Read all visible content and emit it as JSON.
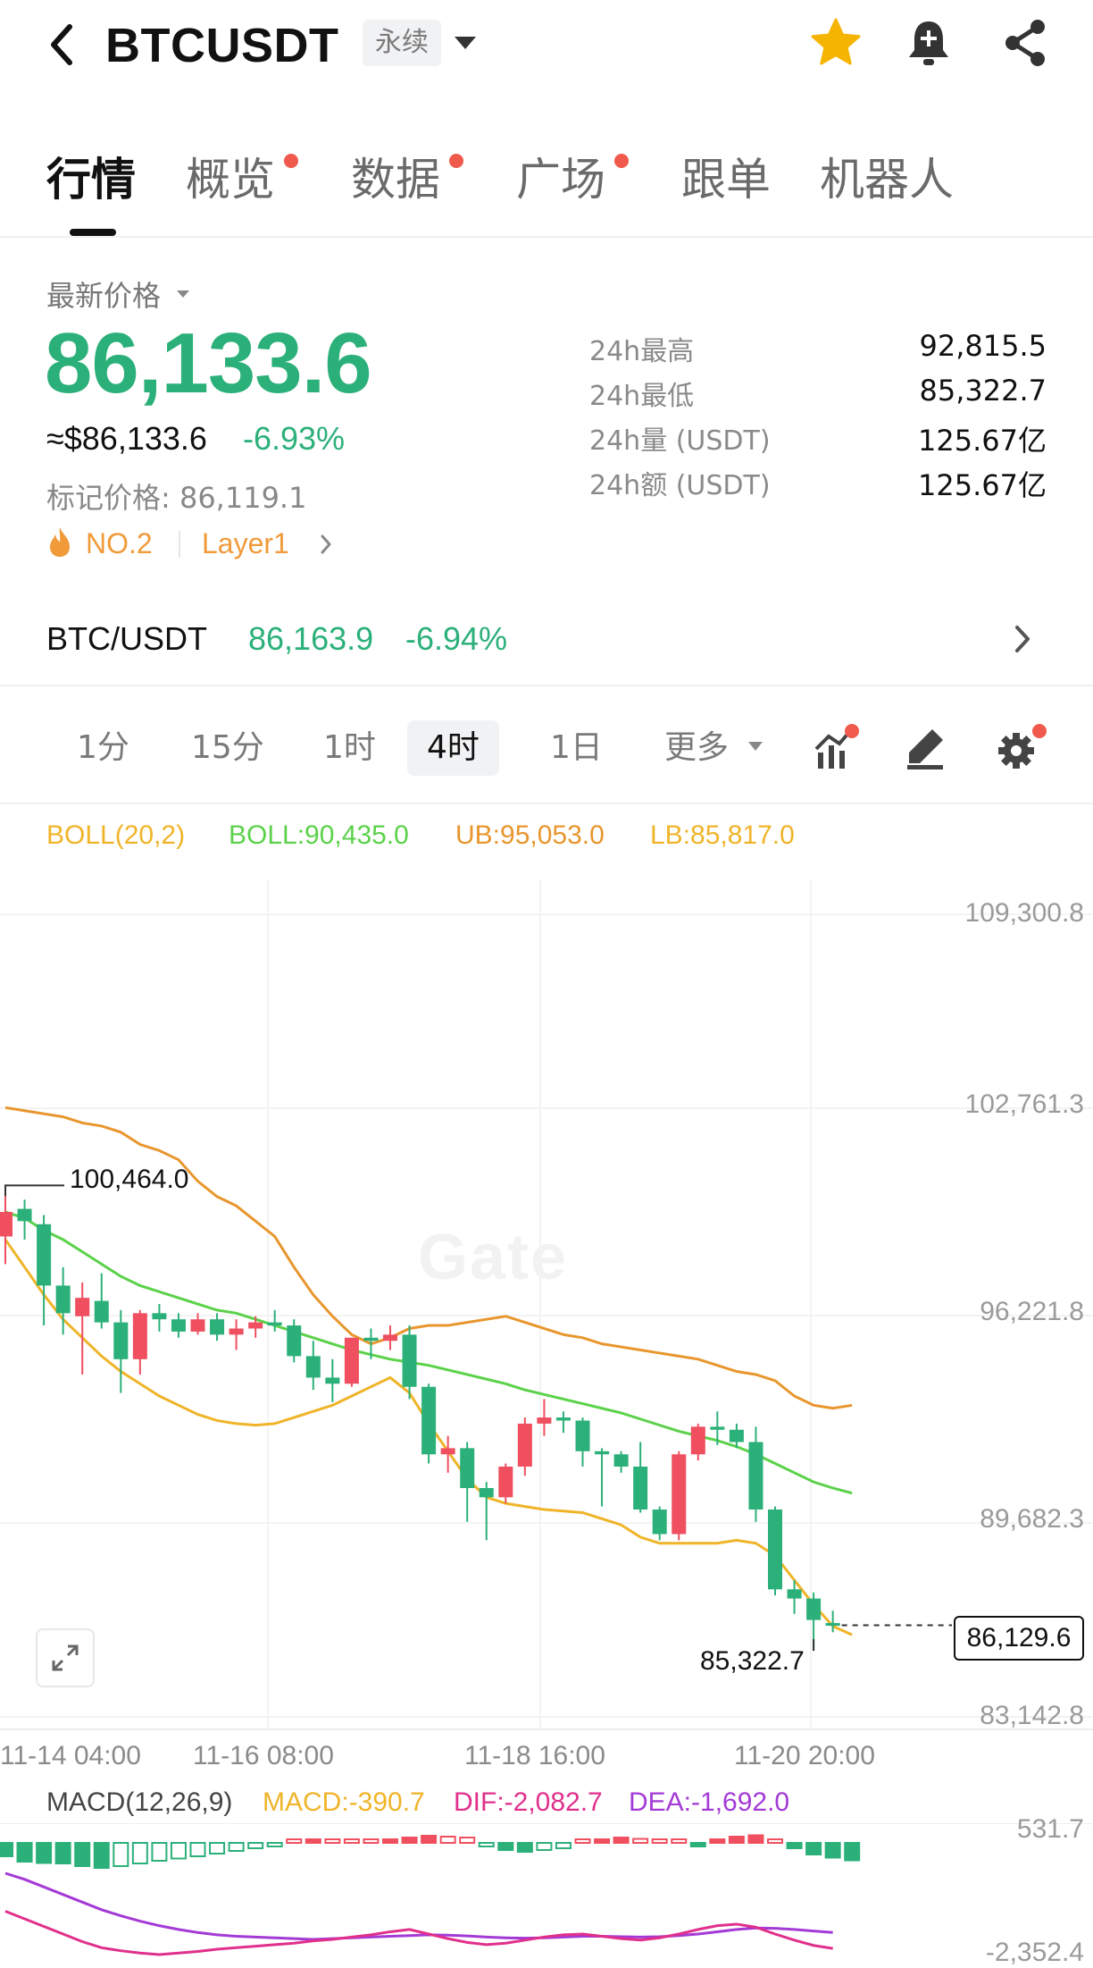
{
  "header": {
    "symbol": "BTCUSDT",
    "contract_type": "永续",
    "icons": [
      "back-icon",
      "chevron-down-icon",
      "star-icon",
      "bell-plus-icon",
      "share-icon"
    ],
    "star_color": "#f5b400"
  },
  "tabs": [
    {
      "label": "行情",
      "active": true,
      "dot": false
    },
    {
      "label": "概览",
      "active": false,
      "dot": true
    },
    {
      "label": "数据",
      "active": false,
      "dot": true
    },
    {
      "label": "广场",
      "active": false,
      "dot": true
    },
    {
      "label": "跟单",
      "active": false,
      "dot": false
    },
    {
      "label": "机器人",
      "active": false,
      "dot": false
    }
  ],
  "price": {
    "label": "最新价格",
    "last": "86,133.6",
    "usd": "≈$86,133.6",
    "change": "-6.93%",
    "mark_price": "标记价格: 86,119.1",
    "rank": "NO.2",
    "tag": "Layer1",
    "color": "#2bb079"
  },
  "stats": [
    {
      "label": "24h最高",
      "value": "92,815.5"
    },
    {
      "label": "24h最低",
      "value": "85,322.7"
    },
    {
      "label": "24h量 (USDT)",
      "value": "125.67亿"
    },
    {
      "label": "24h额 (USDT)",
      "value": "125.67亿"
    }
  ],
  "spot": {
    "pair": "BTC/USDT",
    "price": "86,163.9",
    "change": "-6.94%"
  },
  "timeframes": {
    "items": [
      "1分",
      "15分",
      "1时",
      "4时",
      "1日"
    ],
    "active": "4时",
    "more_label": "更多"
  },
  "boll": {
    "params": "BOLL(20,2)",
    "mid": "BOLL:90,435.0",
    "ub": "UB:95,053.0",
    "lb": "LB:85,817.0",
    "colors": {
      "params": "#f0b429",
      "mid": "#5bd24a",
      "ub": "#e8962d",
      "lb": "#f0b429"
    }
  },
  "chart_data": {
    "type": "candlestick",
    "y_axis_labels": [
      "109,300.8",
      "102,761.3",
      "96,221.8",
      "89,682.3",
      "83,142.8"
    ],
    "ylim": [
      83142.8,
      109300.8
    ],
    "x_labels": [
      "11-14 04:00",
      "11-16 08:00",
      "11-18 16:00",
      "11-20 20:00"
    ],
    "annotations": {
      "high": "100,464.0",
      "low": "85,322.7",
      "current": "86,129.6"
    },
    "watermark": "Gate",
    "up_color": "#ef4f5f",
    "down_color": "#2bb079",
    "candles": [
      {
        "o": 98800,
        "h": 100464,
        "l": 97900,
        "c": 99600
      },
      {
        "o": 99700,
        "h": 100000,
        "l": 98700,
        "c": 99300
      },
      {
        "o": 99200,
        "h": 99500,
        "l": 95900,
        "c": 97200
      },
      {
        "o": 97200,
        "h": 97800,
        "l": 95600,
        "c": 96300
      },
      {
        "o": 96200,
        "h": 97300,
        "l": 94300,
        "c": 96800
      },
      {
        "o": 96700,
        "h": 97600,
        "l": 95800,
        "c": 96000
      },
      {
        "o": 96000,
        "h": 96400,
        "l": 93700,
        "c": 94800
      },
      {
        "o": 94800,
        "h": 96400,
        "l": 94300,
        "c": 96300
      },
      {
        "o": 96300,
        "h": 96600,
        "l": 95700,
        "c": 96100
      },
      {
        "o": 96100,
        "h": 96300,
        "l": 95500,
        "c": 95700
      },
      {
        "o": 95700,
        "h": 96300,
        "l": 95600,
        "c": 96100
      },
      {
        "o": 96100,
        "h": 96300,
        "l": 95400,
        "c": 95600
      },
      {
        "o": 95600,
        "h": 96100,
        "l": 95100,
        "c": 95800
      },
      {
        "o": 95800,
        "h": 96200,
        "l": 95500,
        "c": 96000
      },
      {
        "o": 96000,
        "h": 96400,
        "l": 95700,
        "c": 95900
      },
      {
        "o": 95900,
        "h": 96100,
        "l": 94700,
        "c": 94900
      },
      {
        "o": 94900,
        "h": 95400,
        "l": 93800,
        "c": 94200
      },
      {
        "o": 94200,
        "h": 94800,
        "l": 93400,
        "c": 94000
      },
      {
        "o": 94000,
        "h": 95500,
        "l": 93900,
        "c": 95500
      },
      {
        "o": 95500,
        "h": 95800,
        "l": 94800,
        "c": 95400
      },
      {
        "o": 95400,
        "h": 95900,
        "l": 95100,
        "c": 95600
      },
      {
        "o": 95600,
        "h": 95900,
        "l": 93500,
        "c": 93900
      },
      {
        "o": 93900,
        "h": 94000,
        "l": 91400,
        "c": 91700
      },
      {
        "o": 91700,
        "h": 92300,
        "l": 91100,
        "c": 91900
      },
      {
        "o": 91900,
        "h": 92100,
        "l": 89500,
        "c": 90600
      },
      {
        "o": 90600,
        "h": 90800,
        "l": 88900,
        "c": 90300
      },
      {
        "o": 90300,
        "h": 91400,
        "l": 90100,
        "c": 91300
      },
      {
        "o": 91300,
        "h": 92900,
        "l": 91000,
        "c": 92700
      },
      {
        "o": 92700,
        "h": 93500,
        "l": 92300,
        "c": 92900
      },
      {
        "o": 92900,
        "h": 93100,
        "l": 92400,
        "c": 92800
      },
      {
        "o": 92800,
        "h": 92900,
        "l": 91300,
        "c": 91800
      },
      {
        "o": 91800,
        "h": 91900,
        "l": 90000,
        "c": 91700
      },
      {
        "o": 91700,
        "h": 91800,
        "l": 91100,
        "c": 91300
      },
      {
        "o": 91300,
        "h": 92100,
        "l": 89800,
        "c": 89900
      },
      {
        "o": 89900,
        "h": 90000,
        "l": 88900,
        "c": 89100
      },
      {
        "o": 89100,
        "h": 91800,
        "l": 88900,
        "c": 91700
      },
      {
        "o": 91700,
        "h": 92700,
        "l": 91500,
        "c": 92600
      },
      {
        "o": 92600,
        "h": 93100,
        "l": 92000,
        "c": 92500
      },
      {
        "o": 92500,
        "h": 92700,
        "l": 91900,
        "c": 92100
      },
      {
        "o": 92100,
        "h": 92600,
        "l": 89500,
        "c": 89900
      },
      {
        "o": 89900,
        "h": 90000,
        "l": 87100,
        "c": 87300
      },
      {
        "o": 87300,
        "h": 87600,
        "l": 86500,
        "c": 87000
      },
      {
        "o": 87000,
        "h": 87200,
        "l": 85322.7,
        "c": 86300
      },
      {
        "o": 86200,
        "h": 86600,
        "l": 85900,
        "c": 86129.6
      }
    ],
    "ub": [
      103000,
      102900,
      102800,
      102700,
      102500,
      102400,
      102200,
      101800,
      101600,
      101300,
      100600,
      100100,
      99800,
      99300,
      98800,
      97800,
      96900,
      96200,
      95600,
      95300,
      95500,
      95800,
      95900,
      95900,
      96000,
      96100,
      96200,
      96000,
      95800,
      95600,
      95500,
      95300,
      95200,
      95100,
      95000,
      94900,
      94800,
      94600,
      94400,
      94300,
      94100,
      93600,
      93300,
      93200,
      93300
    ],
    "mid": [
      99600,
      99400,
      99000,
      98700,
      98300,
      97900,
      97500,
      97200,
      97000,
      96800,
      96600,
      96400,
      96300,
      96100,
      95900,
      95700,
      95500,
      95300,
      95100,
      94950,
      94800,
      94700,
      94600,
      94450,
      94300,
      94150,
      94000,
      93800,
      93650,
      93500,
      93350,
      93200,
      93050,
      92850,
      92650,
      92450,
      92300,
      92150,
      91950,
      91700,
      91400,
      91100,
      90800,
      90600,
      90435
    ],
    "lb": [
      98700,
      97800,
      96900,
      96100,
      95500,
      94900,
      94400,
      94000,
      93600,
      93300,
      93000,
      92800,
      92700,
      92650,
      92700,
      92900,
      93100,
      93300,
      93600,
      93900,
      94200,
      93700,
      92700,
      91800,
      90900,
      90300,
      90100,
      90000,
      89900,
      89850,
      89800,
      89600,
      89400,
      89000,
      88800,
      88800,
      88800,
      88800,
      88900,
      88800,
      88400,
      87600,
      86800,
      86100,
      85817
    ]
  },
  "macd": {
    "params": "MACD(12,26,9)",
    "macd": "MACD:-390.7",
    "dif": "DIF:-2,082.7",
    "dea": "DEA:-1,692.0",
    "y_labels": [
      "531.7",
      "-2,352.4"
    ],
    "colors": {
      "params": "#444444",
      "macd": "#f0b429",
      "dif": "#e0308c",
      "dea": "#a43ad6"
    },
    "hist": [
      -300,
      -420,
      -450,
      -460,
      -520,
      -560,
      -520,
      -460,
      -400,
      -350,
      -300,
      -240,
      -180,
      -120,
      -60,
      20,
      60,
      40,
      30,
      20,
      60,
      120,
      160,
      140,
      120,
      -80,
      -160,
      -200,
      -160,
      -120,
      40,
      80,
      120,
      90,
      60,
      30,
      -60,
      60,
      140,
      170,
      80,
      -120,
      -260,
      -330,
      -390.7
    ],
    "dif_series": [
      -1700,
      -1800,
      -1900,
      -2000,
      -2100,
      -2180,
      -2220,
      -2250,
      -2270,
      -2250,
      -2230,
      -2200,
      -2180,
      -2160,
      -2140,
      -2120,
      -2090,
      -2070,
      -2040,
      -2010,
      -1970,
      -1940,
      -2000,
      -2060,
      -2110,
      -2140,
      -2120,
      -2080,
      -2040,
      -2010,
      -2000,
      -2030,
      -2060,
      -2080,
      -2050,
      -2000,
      -1940,
      -1890,
      -1870,
      -1910,
      -2000,
      -2080,
      -2150,
      -2190,
      -2082.7
    ],
    "dea_series": [
      -1200,
      -1280,
      -1380,
      -1480,
      -1580,
      -1680,
      -1760,
      -1830,
      -1890,
      -1940,
      -1980,
      -2010,
      -2030,
      -2040,
      -2050,
      -2060,
      -2070,
      -2060,
      -2050,
      -2040,
      -2030,
      -2020,
      -2010,
      -2015,
      -2025,
      -2040,
      -2050,
      -2055,
      -2050,
      -2040,
      -2030,
      -2030,
      -2035,
      -2040,
      -2035,
      -2020,
      -2000,
      -1970,
      -1940,
      -1920,
      -1925,
      -1940,
      -1960,
      -1980,
      -1692.0
    ]
  }
}
